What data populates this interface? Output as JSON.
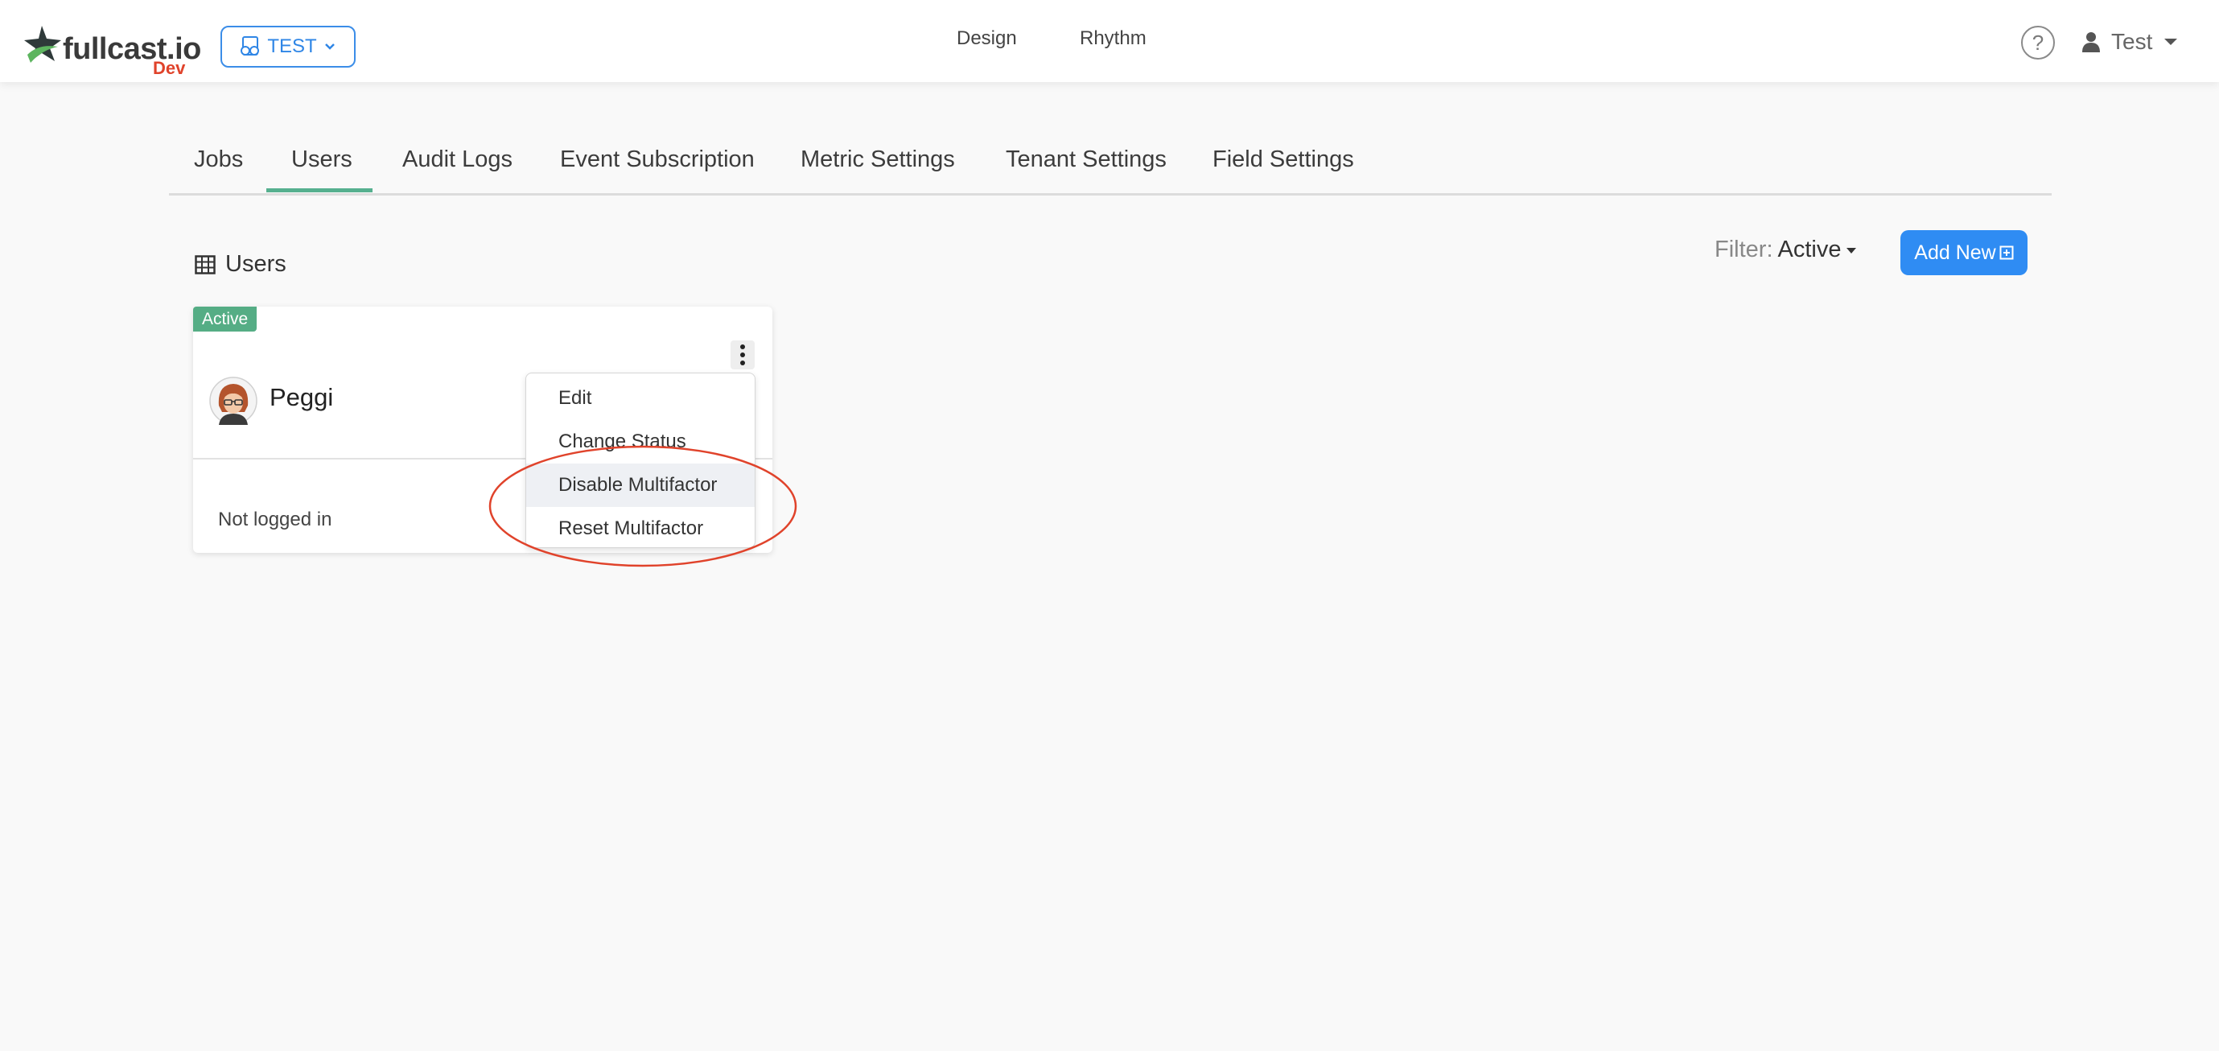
{
  "header": {
    "logo_text": "fullcast.io",
    "environment": "Dev",
    "tenant_label": "TEST",
    "nav": [
      "Design",
      "Rhythm"
    ],
    "help_symbol": "?",
    "user_name": "Test"
  },
  "tabs": {
    "items": [
      "Jobs",
      "Users",
      "Audit Logs",
      "Event Subscription",
      "Metric Settings",
      "Tenant Settings",
      "Field Settings"
    ],
    "active": "Users"
  },
  "section": {
    "title": "Users",
    "filter_label": "Filter:",
    "filter_value": "Active",
    "add_button": "Add New"
  },
  "user_card": {
    "status": "Active",
    "name": "Peggi",
    "login_status": "Not logged in"
  },
  "context_menu": {
    "items": [
      "Edit",
      "Change Status",
      "Disable Multifactor",
      "Reset Multifactor"
    ],
    "hovered": "Disable Multifactor"
  },
  "colors": {
    "primary": "#2f8cf3",
    "active_tab": "#56b08f",
    "status_active": "#55ad85",
    "env_label": "#e0432b",
    "annotation": "#e0432b"
  },
  "icons": {
    "logo": "star-icon",
    "tenant": "glasses-document-icon",
    "help": "question-circle-icon",
    "user": "user-icon",
    "section": "table-icon",
    "add": "plus-square-icon",
    "menu": "kebab-icon"
  }
}
